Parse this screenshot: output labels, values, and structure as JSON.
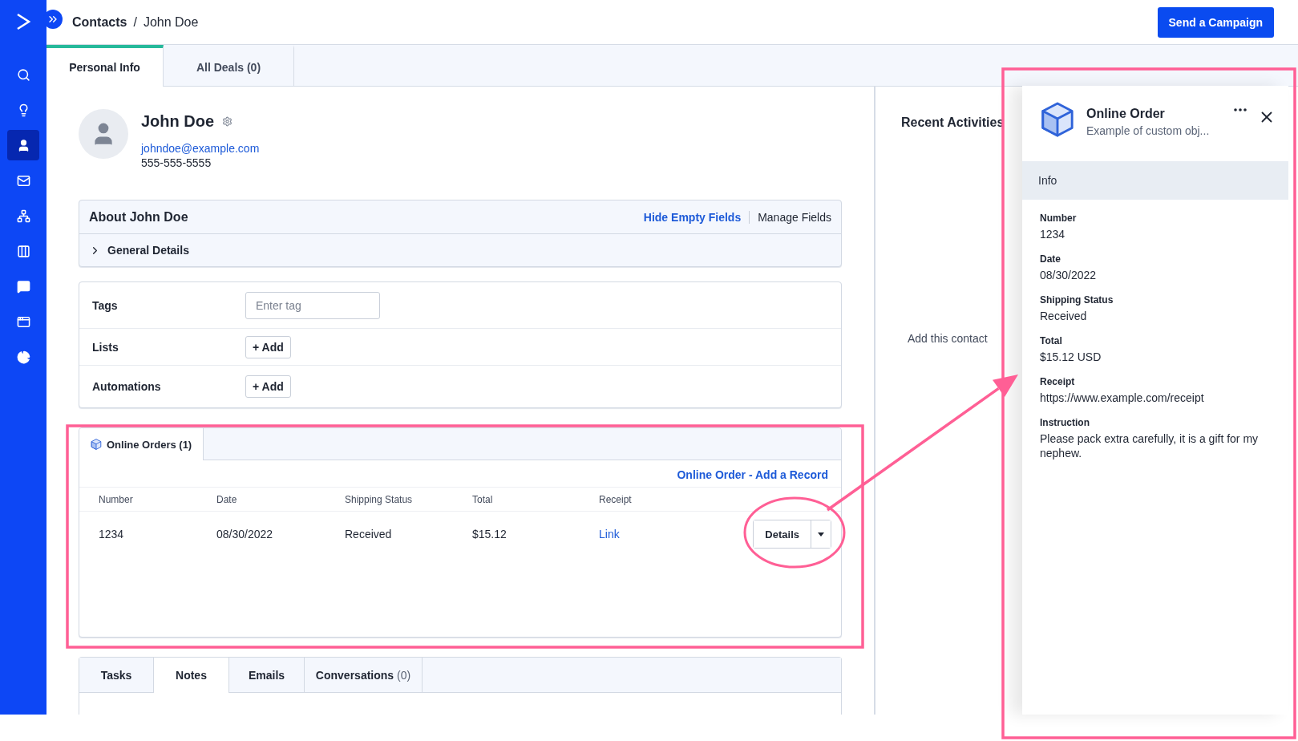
{
  "header": {
    "breadcrumb_parent": "Contacts",
    "separator": "/",
    "breadcrumb_current": "John Doe",
    "primary_action": "Send a Campaign"
  },
  "nav": [
    {
      "kind": "logo",
      "selected": false
    },
    {
      "kind": "search",
      "selected": false
    },
    {
      "kind": "idea",
      "selected": false
    },
    {
      "kind": "contacts",
      "selected": true
    },
    {
      "kind": "mail",
      "selected": false
    },
    {
      "kind": "flow",
      "selected": false
    },
    {
      "kind": "board",
      "selected": false
    },
    {
      "kind": "chat",
      "selected": false
    },
    {
      "kind": "window",
      "selected": false
    },
    {
      "kind": "report",
      "selected": false
    }
  ],
  "tabs": [
    {
      "label": "Personal Info",
      "selected": true
    },
    {
      "label": "All Deals (0)",
      "selected": false
    }
  ],
  "contact": {
    "name": "John Doe",
    "email": "johndoe@example.com",
    "phone": "555-555-5555"
  },
  "about": {
    "title": "About John Doe",
    "actions": [
      {
        "label": "Hide Empty Fields",
        "kind": "primary"
      },
      {
        "label": "Manage Fields",
        "kind": "plain"
      }
    ],
    "sections": [
      {
        "label": "General Details",
        "expanded": false
      }
    ]
  },
  "fields": [
    {
      "kind": "input",
      "label": "Tags",
      "placeholder": "Enter tag"
    },
    {
      "kind": "add",
      "label": "Lists",
      "button": "+ Add"
    },
    {
      "kind": "add",
      "label": "Automations",
      "button": "+ Add"
    }
  ],
  "orders": {
    "tab": "Online Orders (1)",
    "add_link": "Online Order - Add a Record",
    "columns": [
      "Number",
      "Date",
      "Shipping Status",
      "Total",
      "Receipt"
    ],
    "rows": [
      {
        "number": "1234",
        "date": "08/30/2022",
        "status": "Received",
        "total": "$15.12",
        "receipt": "Link",
        "action": "Details"
      }
    ]
  },
  "activity_tabs": [
    {
      "label": "Tasks",
      "selected": false
    },
    {
      "label": "Notes",
      "selected": true
    },
    {
      "label": "Emails",
      "selected": false
    },
    {
      "label": "Conversations",
      "count": "(0)",
      "selected": false
    }
  ],
  "recent": {
    "title": "Recent Activities",
    "empty_text": "Add this contact"
  },
  "drawer": {
    "title": "Online Order",
    "subtitle": "Example of custom obj...",
    "section": "Info",
    "fields": [
      {
        "label": "Number",
        "value": "1234"
      },
      {
        "label": "Date",
        "value": "08/30/2022"
      },
      {
        "label": "Shipping Status",
        "value": "Received"
      },
      {
        "label": "Total",
        "value": "$15.12 USD"
      },
      {
        "label": "Receipt",
        "value": "https://www.example.com/receipt"
      },
      {
        "label": "Instruction",
        "value": "Please pack extra carefully, it is a gift for my nephew."
      }
    ]
  },
  "annotations": [
    {
      "kind": "frame"
    },
    {
      "kind": "frame"
    },
    {
      "kind": "ellipse"
    },
    {
      "kind": "arrow"
    }
  ]
}
